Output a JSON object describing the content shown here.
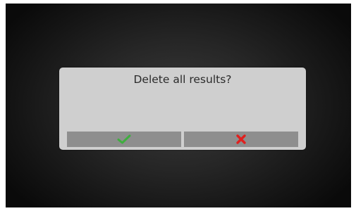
{
  "dialog": {
    "message": "Delete all results?",
    "confirm_icon": "check-icon",
    "cancel_icon": "cross-icon"
  },
  "colors": {
    "confirm_icon": "#3fae3f",
    "cancel_icon": "#e0201e",
    "dialog_background": "#cfcfcf",
    "button_background": "#8e8e8e"
  }
}
